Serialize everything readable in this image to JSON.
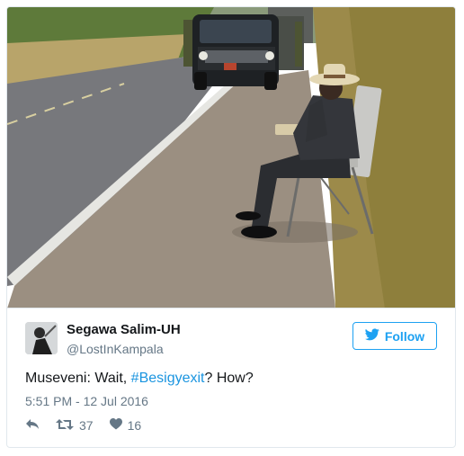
{
  "tweet": {
    "author_name": "Segawa Salim-UH",
    "author_handle": "@LostInKampala",
    "follow_label": "Follow",
    "text_prefix": "Museveni: Wait, ",
    "hashtag": "#Besigyexit",
    "text_suffix": "? How?",
    "timestamp": "5:51 PM - 12 Jul 2016",
    "retweet_count": "37",
    "like_count": "16"
  },
  "colors": {
    "accent": "#1da1f2",
    "hashtag": "#1b95e0",
    "muted": "#657786",
    "text": "#14171a",
    "border": "#e1e8ed"
  },
  "icons": {
    "follow": "twitter-bird-icon",
    "reply": "reply-arrow-icon",
    "retweet": "retweet-icon",
    "like": "heart-icon"
  }
}
